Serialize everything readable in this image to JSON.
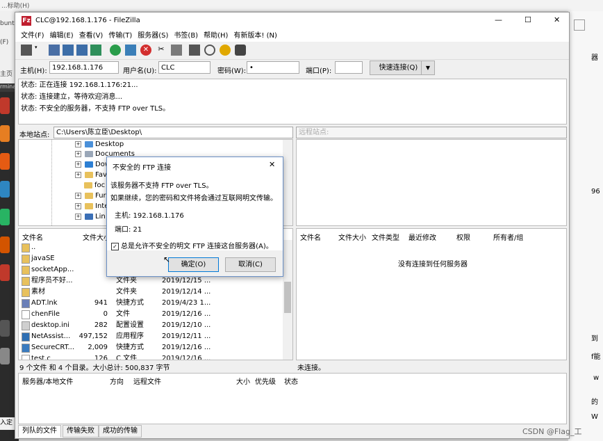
{
  "background": {
    "top_left_text": "...标助(H)",
    "side_labels": [
      "buntu",
      "(F)",
      "主页",
      "rminal"
    ],
    "right_labels": [
      "器",
      "96",
      "到",
      "f能",
      "w",
      "的",
      "W"
    ],
    "bottom_left": "入定",
    "watermark": "CSDN @Flag_工"
  },
  "window": {
    "title": "CLC@192.168.1.176 - FileZilla",
    "minimize": "—",
    "maximize": "☐",
    "close": "✕"
  },
  "menu": [
    "文件(F)",
    "编辑(E)",
    "查看(V)",
    "传输(T)",
    "服务器(S)",
    "书签(B)",
    "帮助(H)",
    "有新版本! (N)"
  ],
  "toolbar_icons": [
    "site-manager-icon",
    "toggle-log-icon",
    "toggle-local-tree-icon",
    "toggle-remote-tree-icon",
    "toggle-queue-icon",
    "refresh-icon",
    "process-queue-icon",
    "cancel-icon",
    "disconnect-icon",
    "reconnect-icon",
    "filter-icon",
    "toggle-compare-icon",
    "sync-browse-icon",
    "search-icon"
  ],
  "quickconnect": {
    "host_label": "主机(H):",
    "host_value": "192.168.1.176",
    "user_label": "用户名(U):",
    "user_value": "CLC",
    "pass_label": "密码(W):",
    "pass_value": "•",
    "port_label": "端口(P):",
    "port_value": "",
    "connect_button": "快速连接(Q)",
    "dropdown": "▼"
  },
  "log": [
    "状态: 正在连接 192.168.1.176:21...",
    "状态: 连接建立，等待欢迎消息...",
    "状态: 不安全的服务器，不支持 FTP over TLS。"
  ],
  "local": {
    "path_label": "本地站点:",
    "path_value": "C:\\Users\\陈立臣\\Desktop\\",
    "tree": [
      "Desktop",
      "Documents",
      "Dow",
      "Fav",
      "foc",
      "Fur",
      "Inte",
      "Lin"
    ],
    "headers": {
      "name": "文件名",
      "size": "文件大小"
    },
    "rows": [
      {
        "name": "..",
        "size": "",
        "type": "",
        "modified": ""
      },
      {
        "name": "javaSE",
        "size": "",
        "type": "",
        "modified": ""
      },
      {
        "name": "socketApp...",
        "size": "",
        "type": "",
        "modified": ""
      },
      {
        "name": "程序员不好...",
        "size": "",
        "type": "文件夹",
        "modified": "2019/12/15 ..."
      },
      {
        "name": "素材",
        "size": "",
        "type": "文件夹",
        "modified": "2019/12/14 ..."
      },
      {
        "name": "ADT.lnk",
        "size": "941",
        "type": "快捷方式",
        "modified": "2019/4/23 1..."
      },
      {
        "name": "chenFile",
        "size": "0",
        "type": "文件",
        "modified": "2019/12/16 ..."
      },
      {
        "name": "desktop.ini",
        "size": "282",
        "type": "配置设置",
        "modified": "2019/12/10 ..."
      },
      {
        "name": "NetAssist...",
        "size": "497,152",
        "type": "应用程序",
        "modified": "2019/12/11 ..."
      },
      {
        "name": "SecureCRT...",
        "size": "2,009",
        "type": "快捷方式",
        "modified": "2019/12/16 ..."
      },
      {
        "name": "test.c",
        "size": "126",
        "type": "C 文件",
        "modified": "2019/12/16 ..."
      }
    ],
    "status": "9 个文件 和 4 个目录。大小总计: 500,837 字节"
  },
  "remote": {
    "path_label": "远程站点:",
    "path_value": "",
    "headers": {
      "name": "文件名",
      "size": "文件大小",
      "type": "文件类型",
      "modified": "最近修改",
      "perms": "权限",
      "owner": "所有者/组"
    },
    "empty_message": "没有连接到任何服务器",
    "status": "未连接。"
  },
  "queue": {
    "headers": {
      "server": "服务器/本地文件",
      "direction": "方向",
      "remote": "远程文件",
      "size": "大小",
      "priority": "优先级",
      "status": "状态"
    },
    "tabs": [
      "列队的文件",
      "传输失败",
      "成功的传输"
    ]
  },
  "dialog": {
    "title": "不安全的 FTP 连接",
    "close": "✕",
    "line1": "该服务器不支持 FTP over TLS。",
    "line2": "如果继续，您的密码和文件将会通过互联网明文传输。",
    "host": "主机: 192.168.1.176",
    "port": "端口: 21",
    "checkbox_label": "总是允许不安全的明文 FTP 连接这台服务器(A)。",
    "checkbox_mark": "✓",
    "ok": "确定(O)",
    "cancel": "取消(C)"
  },
  "colors": {
    "accent": "#0078d7",
    "folder": "#e8c15c",
    "app_icon_red": "#c4332a"
  }
}
